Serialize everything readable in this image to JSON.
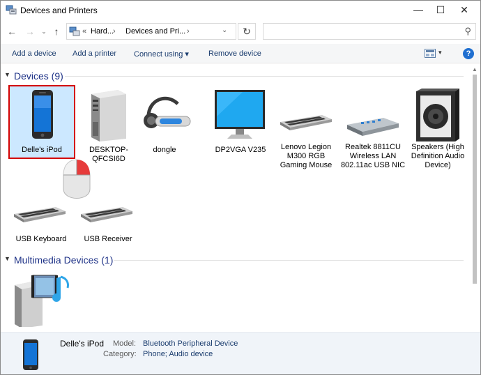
{
  "window": {
    "title": "Devices and Printers",
    "minimize": "—",
    "maximize": "☐",
    "close": "✕"
  },
  "nav": {
    "back": "←",
    "forward": "→",
    "recent": "⌄",
    "up": "↑",
    "address_chevron": "«",
    "address_part1": "Hard...",
    "address_sep": "›",
    "address_part2": "Devices and Pri...",
    "address_dropdown": "⌄",
    "refresh": "↻",
    "search_placeholder": "",
    "search_icon": "⚲"
  },
  "commands": {
    "add_device": "Add a device",
    "add_printer": "Add a printer",
    "connect_using": "Connect using  ▾",
    "remove_device": "Remove device",
    "view_dropdown": "▾",
    "help": "?"
  },
  "groups": [
    {
      "title": "Devices (9)",
      "devices": [
        {
          "label": "Delle's iPod",
          "icon": "phone-icon",
          "selected": true
        },
        {
          "label": "DESKTOP-QFCSI6D",
          "icon": "tower-pc-icon"
        },
        {
          "label": "dongle",
          "icon": "headset-icon"
        },
        {
          "label": "DP2VGA V235",
          "icon": "monitor-icon"
        },
        {
          "label": "Lenovo Legion M300 RGB Gaming Mouse",
          "icon": "keyboard-icon"
        },
        {
          "label": "Realtek 8811CU Wireless LAN 802.11ac USB NIC",
          "icon": "network-adapter-icon"
        },
        {
          "label": "Speakers (High Definition Audio Device)",
          "icon": "speaker-icon"
        },
        {
          "label": "USB Keyboard",
          "icon": "keyboard-icon"
        },
        {
          "label": "USB Receiver",
          "icon": "keyboard-icon"
        }
      ]
    },
    {
      "title": "Multimedia Devices (1)",
      "devices": [
        {
          "label": "",
          "icon": "media-server-icon"
        }
      ]
    }
  ],
  "details": {
    "name": "Delle's iPod",
    "model_label": "Model:",
    "model_value": "Bluetooth Peripheral Device",
    "category_label": "Category:",
    "category_value": "Phone; Audio device"
  },
  "colors": {
    "group_title": "#1e3287",
    "selection_bg": "#cce8ff",
    "selection_outline": "#d40000",
    "command_text": "#1a3c6e"
  }
}
